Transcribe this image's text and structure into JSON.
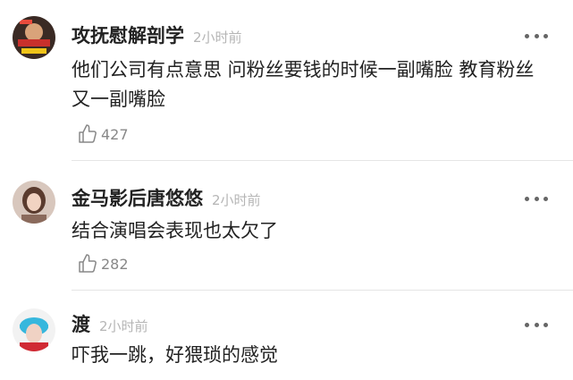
{
  "comments": [
    {
      "username": "攻抚慰解剖学",
      "time": "2小时前",
      "text": "他们公司有点意思 问粉丝要钱的时候一副嘴脸 教育粉丝又一副嘴脸",
      "likes": "427",
      "avatar_icon": "user-avatar",
      "more_icon": "more-options-icon",
      "like_icon": "thumbs-up-icon"
    },
    {
      "username": "金马影后唐悠悠",
      "time": "2小时前",
      "text": "结合演唱会表现也太欠了",
      "likes": "282",
      "avatar_icon": "user-avatar",
      "more_icon": "more-options-icon",
      "like_icon": "thumbs-up-icon"
    },
    {
      "username": "渡",
      "time": "2小时前",
      "text": "吓我一跳，好猥琐的感觉",
      "avatar_icon": "user-avatar",
      "more_icon": "more-options-icon"
    }
  ],
  "colors": {
    "name": "#222222",
    "time": "#b5b5b5",
    "like": "#888888",
    "divider": "#e5e5e5"
  }
}
